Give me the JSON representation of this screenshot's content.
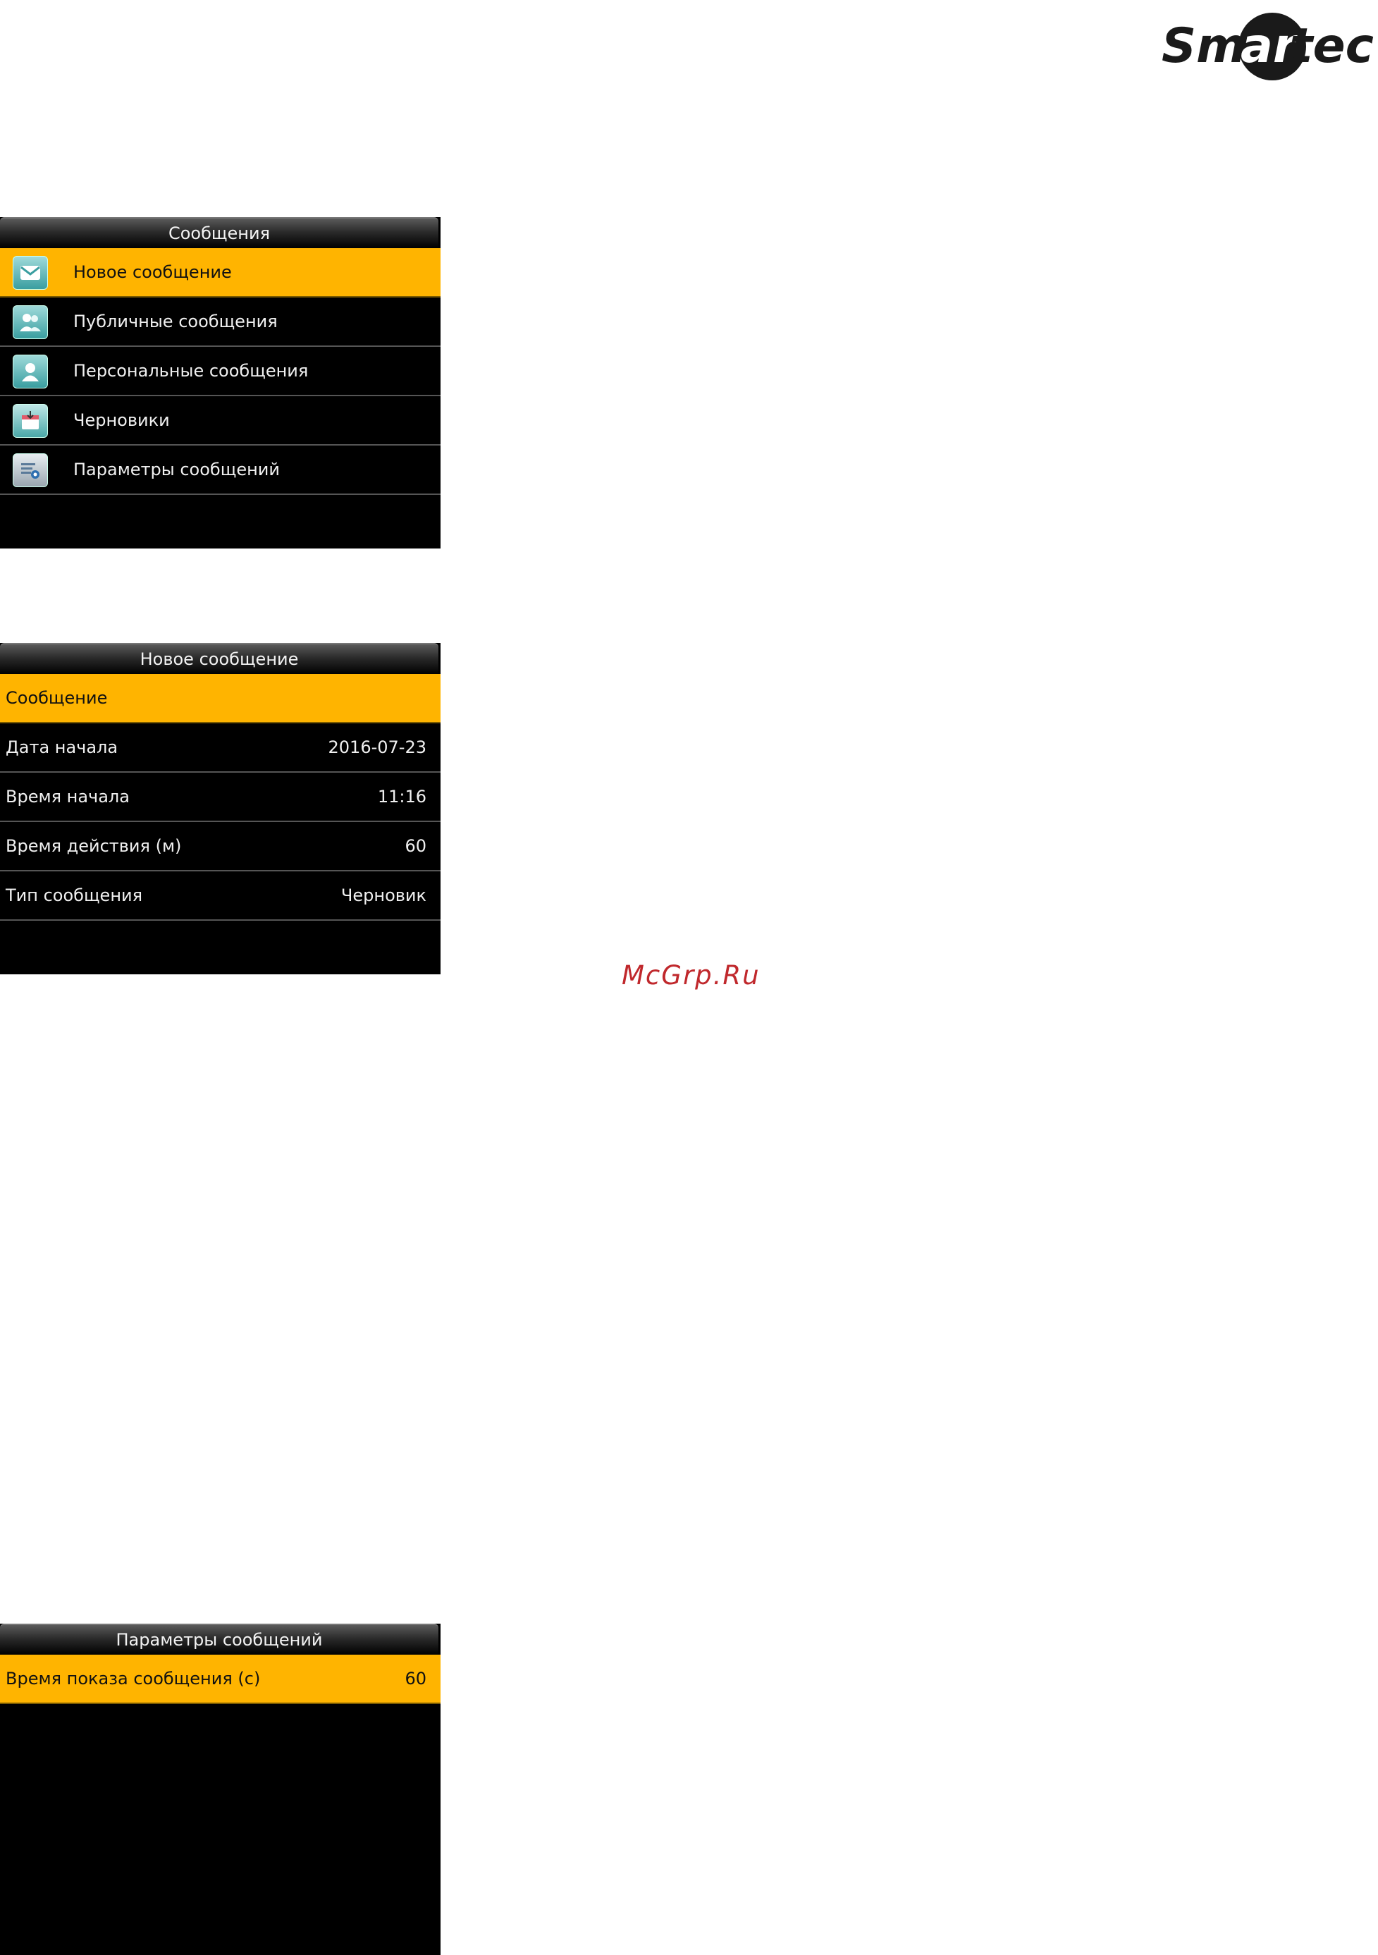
{
  "logo": {
    "text": "Smartec"
  },
  "watermark": "McGrp.Ru",
  "screen1": {
    "title": "Сообщения",
    "items": [
      {
        "label": "Новое сообщение",
        "icon": "new-message-icon"
      },
      {
        "label": "Публичные сообщения",
        "icon": "public-messages-icon"
      },
      {
        "label": "Персональные сообщения",
        "icon": "personal-messages-icon"
      },
      {
        "label": "Черновики",
        "icon": "drafts-icon"
      },
      {
        "label": "Параметры сообщений",
        "icon": "message-settings-icon"
      }
    ]
  },
  "screen2": {
    "title": "Новое сообщение",
    "rows": [
      {
        "label": "Сообщение",
        "value": ""
      },
      {
        "label": "Дата начала",
        "value": "2016-07-23"
      },
      {
        "label": "Время начала",
        "value": "11:16"
      },
      {
        "label": "Время действия (м)",
        "value": "60"
      },
      {
        "label": "Тип сообщения",
        "value": "Черновик"
      }
    ]
  },
  "screen3": {
    "title": "Параметры сообщений",
    "rows": [
      {
        "label": "Время показа сообщения (с)",
        "value": "60"
      }
    ]
  },
  "colors": {
    "selected": "#ffb400",
    "screen_bg": "#000000",
    "watermark": "#c0282c"
  }
}
